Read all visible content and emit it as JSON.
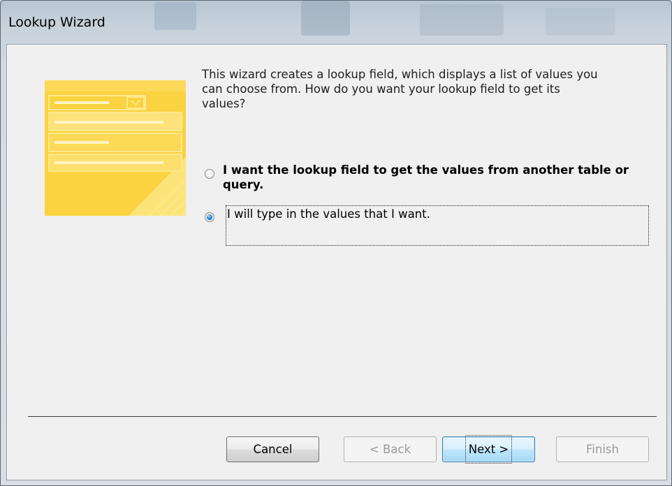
{
  "window": {
    "title": "Lookup Wizard"
  },
  "wizard": {
    "prompt": "This wizard creates a lookup field, which displays a list of values you\ncan choose from.  How do you want your lookup field to get its\nvalues?",
    "options": [
      {
        "label": "I want the lookup field to get the values from another table or\nquery.",
        "selected": false
      },
      {
        "label": "I will type in the values that I want.",
        "selected": true
      }
    ]
  },
  "buttons": {
    "cancel": "Cancel",
    "back": "< Back",
    "next": "Next >",
    "finish": "Finish"
  },
  "colors": {
    "illustration_yellow": "#fbd240",
    "default_button_border": "#3c7fb1",
    "disabled_text": "#9a9a9a"
  }
}
